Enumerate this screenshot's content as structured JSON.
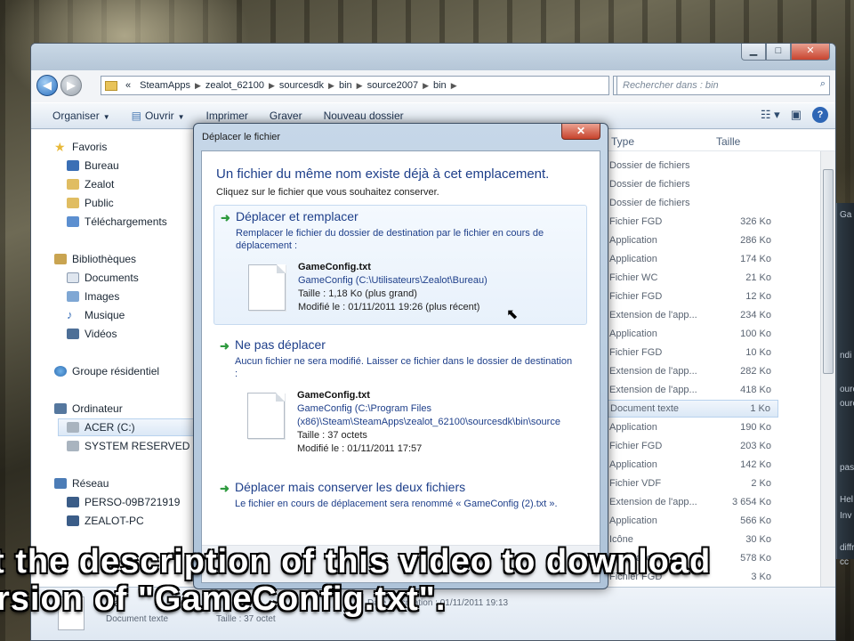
{
  "explorer": {
    "address_crumbs": [
      "«",
      "SteamApps",
      "zealot_62100",
      "sourcesdk",
      "bin",
      "source2007",
      "bin"
    ],
    "search_placeholder": "Rechercher dans : bin",
    "toolbar": {
      "organize": "Organiser",
      "open": "Ouvrir",
      "print": "Imprimer",
      "burn": "Graver",
      "new_folder": "Nouveau dossier"
    },
    "nav": {
      "favorites": "Favoris",
      "desktop": "Bureau",
      "user": "Zealot",
      "public": "Public",
      "downloads": "Téléchargements",
      "libraries": "Bibliothèques",
      "documents": "Documents",
      "images": "Images",
      "music": "Musique",
      "videos": "Vidéos",
      "homegroup": "Groupe résidentiel",
      "computer": "Ordinateur",
      "drive_c": "ACER (C:)",
      "drive_f": "SYSTEM RESERVED (F:)",
      "network": "Réseau",
      "pc1": "PERSO-09B721919",
      "pc2": "ZEALOT-PC"
    },
    "columns": {
      "type": "Type",
      "size": "Taille"
    },
    "files": [
      {
        "type": "Dossier de fichiers",
        "size": ""
      },
      {
        "type": "Dossier de fichiers",
        "size": ""
      },
      {
        "type": "Dossier de fichiers",
        "size": ""
      },
      {
        "type": "Fichier FGD",
        "size": "326 Ko"
      },
      {
        "type": "Application",
        "size": "286 Ko"
      },
      {
        "type": "Application",
        "size": "174 Ko"
      },
      {
        "type": "Fichier WC",
        "size": "21 Ko"
      },
      {
        "type": "Fichier FGD",
        "size": "12 Ko"
      },
      {
        "type": "Extension de l'app...",
        "size": "234 Ko"
      },
      {
        "type": "Application",
        "size": "100 Ko"
      },
      {
        "type": "Fichier FGD",
        "size": "10 Ko"
      },
      {
        "type": "Extension de l'app...",
        "size": "282 Ko"
      },
      {
        "type": "Extension de l'app...",
        "size": "418 Ko"
      },
      {
        "type": "Document texte",
        "size": "1 Ko"
      },
      {
        "type": "Application",
        "size": "190 Ko"
      },
      {
        "type": "Fichier FGD",
        "size": "203 Ko"
      },
      {
        "type": "Application",
        "size": "142 Ko"
      },
      {
        "type": "Fichier VDF",
        "size": "2 Ko"
      },
      {
        "type": "Extension de l'app...",
        "size": "3 654 Ko"
      },
      {
        "type": "Application",
        "size": "566 Ko"
      },
      {
        "type": "Icône",
        "size": "30 Ko"
      },
      {
        "type": "Application",
        "size": "578 Ko"
      },
      {
        "type": "Fichier FGD",
        "size": "3 Ko"
      }
    ],
    "details": {
      "name": "Ga",
      "type": "Document texte",
      "created_label": "Date de création : 01/11/2011 19:13",
      "size_label": "Taille : 37 octet"
    }
  },
  "dialog": {
    "title": "Déplacer le fichier",
    "heading": "Un fichier du même nom existe déjà à cet emplacement.",
    "subheading": "Cliquez sur le fichier que vous souhaitez conserver.",
    "options": [
      {
        "title": "Déplacer et remplacer",
        "description": "Remplacer le fichier du dossier de destination par le fichier en cours de déplacement :",
        "file_name": "GameConfig.txt",
        "file_path": "GameConfig (C:\\Utilisateurs\\Zealot\\Bureau)",
        "file_size": "Taille : 1,18 Ko (plus grand)",
        "file_modified": "Modifié le : 01/11/2011 19:26 (plus récent)"
      },
      {
        "title": "Ne pas déplacer",
        "description": "Aucun fichier ne sera modifié. Laisser ce fichier dans le dossier de destination :",
        "file_name": "GameConfig.txt",
        "file_path_1": "GameConfig (C:\\Program Files",
        "file_path_2": "(x86)\\Steam\\SteamApps\\zealot_62100\\sourcesdk\\bin\\source",
        "file_size": "Taille : 37 octets",
        "file_modified": "Modifié le : 01/11/2011 17:57"
      },
      {
        "title": "Déplacer mais conserver les deux fichiers",
        "description": "Le fichier en cours de déplacement sera renommé « GameConfig (2).txt »."
      }
    ]
  },
  "captions": {
    "line1": "t the description of this video to download",
    "line2": "rsion of \"GameConfig.txt\"."
  },
  "side_window": {
    "lines": [
      "Ga",
      "ndi",
      "ourc",
      "ourc",
      "pas",
      "Hel",
      "Inv",
      "diffr",
      "cc"
    ]
  },
  "colors": {
    "dialog_link": "#1e3f8a",
    "arrow_green": "#2e9a3e",
    "close_red": "#c7432c"
  }
}
